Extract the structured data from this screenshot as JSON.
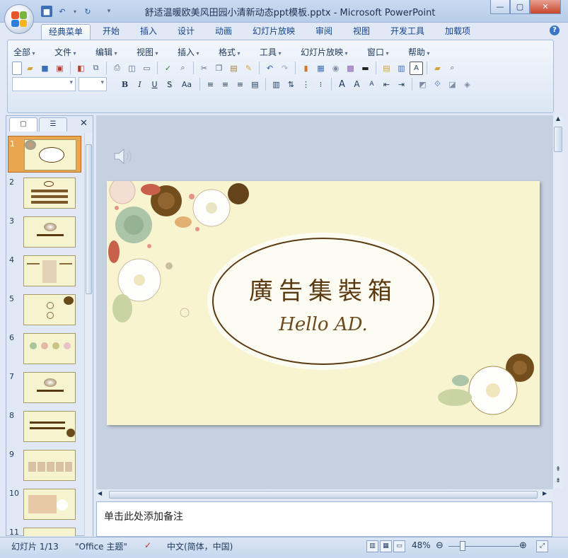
{
  "app": {
    "title": "舒适温暖欧美风田园小清新动态ppt模板.pptx - Microsoft PowerPoint",
    "window_controls": [
      "—",
      "▢",
      "✕"
    ]
  },
  "ribbon": {
    "tabs": [
      {
        "label": "经典菜单",
        "active": true
      },
      {
        "label": "开始"
      },
      {
        "label": "插入"
      },
      {
        "label": "设计"
      },
      {
        "label": "动画"
      },
      {
        "label": "幻灯片放映"
      },
      {
        "label": "审阅"
      },
      {
        "label": "视图"
      },
      {
        "label": "开发工具"
      },
      {
        "label": "加载项"
      }
    ],
    "menu": [
      "全部",
      "文件",
      "编辑",
      "视图",
      "插入",
      "格式",
      "工具",
      "幻灯片放映",
      "窗口",
      "帮助"
    ],
    "format_buttons": [
      "B",
      "I",
      "U",
      "S",
      "Aa"
    ],
    "font_size_labels": [
      "A",
      "A",
      "A"
    ],
    "help_label": "?"
  },
  "sidebar": {
    "slide_numbers": [
      "1",
      "2",
      "3",
      "4",
      "5",
      "6",
      "7",
      "8",
      "9",
      "10",
      "11"
    ],
    "selected": 1,
    "close_label": "✕"
  },
  "slide": {
    "title": "廣告集裝箱",
    "subtitle": "Hello AD."
  },
  "notes": {
    "placeholder": "单击此处添加备注"
  },
  "status": {
    "slide_info": "幻灯片 1/13",
    "theme": "\"Office 主题\"",
    "language": "中文(简体，中国)",
    "zoom": "48%"
  },
  "colors": {
    "accent": "#e9a64f",
    "slide_bg": "#f7f4cf",
    "title_brown": "#5b3a12"
  }
}
